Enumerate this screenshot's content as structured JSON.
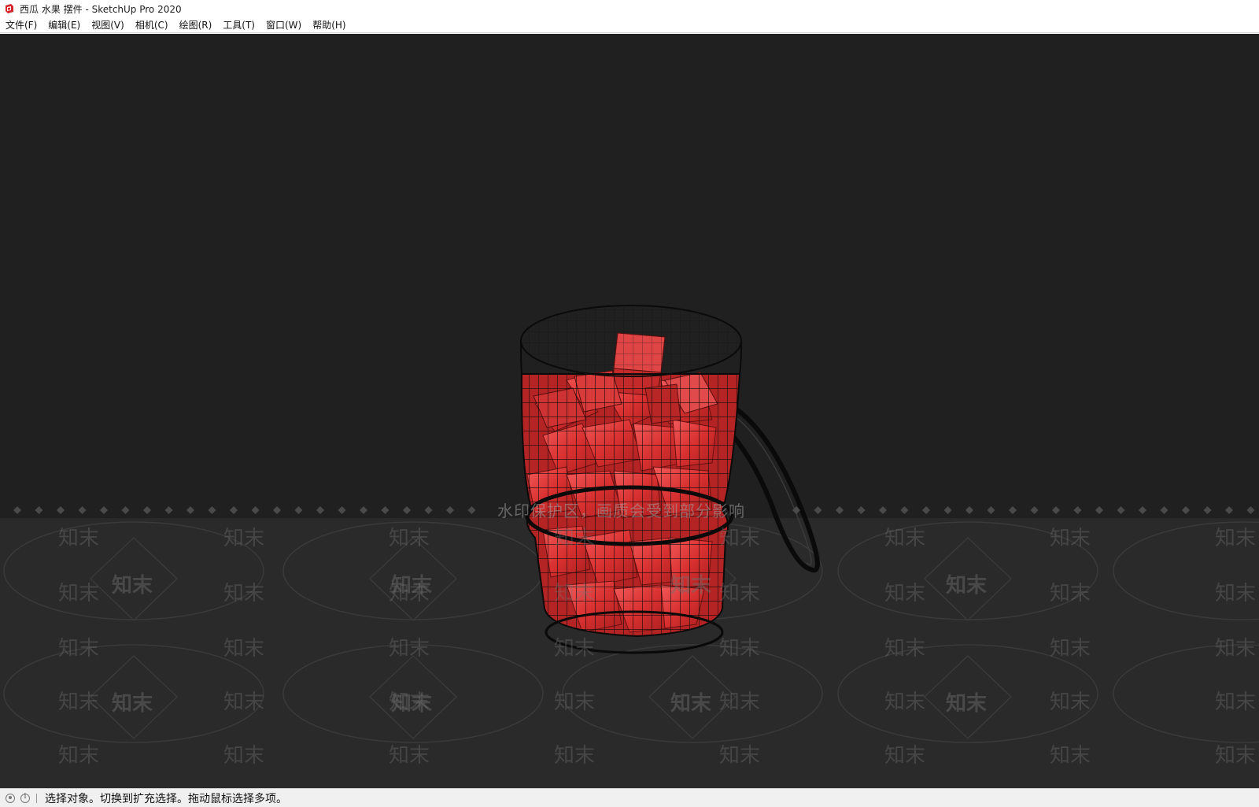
{
  "window": {
    "title": "西瓜 水果 摆件 - SketchUp Pro 2020"
  },
  "menu": {
    "items": [
      {
        "label": "文件(F)"
      },
      {
        "label": "编辑(E)"
      },
      {
        "label": "视图(V)"
      },
      {
        "label": "相机(C)"
      },
      {
        "label": "绘图(R)"
      },
      {
        "label": "工具(T)"
      },
      {
        "label": "窗口(W)"
      },
      {
        "label": "帮助(H)"
      }
    ]
  },
  "viewport": {
    "watermark_notice": "水印保护区，画质会受到部分影响",
    "watermark_text": "知末",
    "background_color": "#202020",
    "accent_color": "#e03535"
  },
  "statusbar": {
    "hint": "选择对象。切换到扩充选择。拖动鼠标选择多项。",
    "icons": [
      "geo-location-icon",
      "info-icon"
    ]
  }
}
